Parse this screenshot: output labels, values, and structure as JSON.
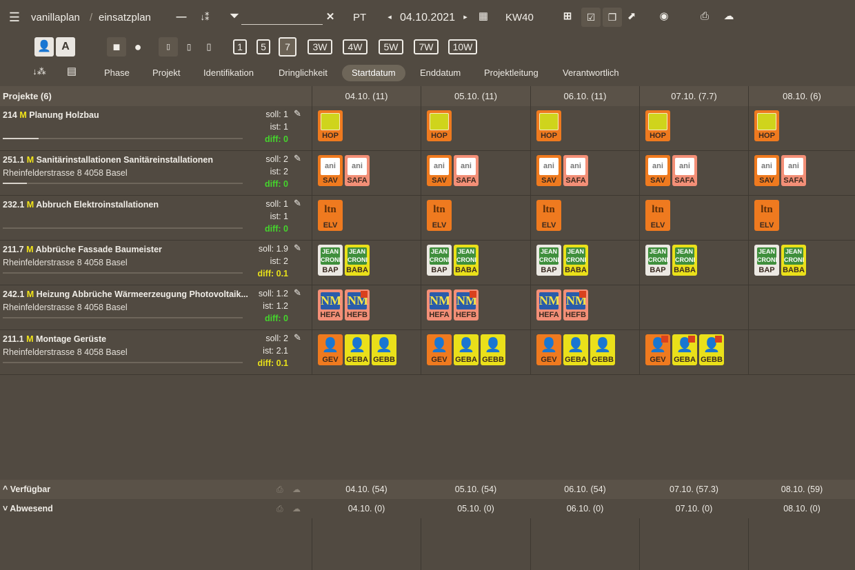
{
  "breadcrumb": {
    "root": "vanillaplan",
    "sep": "/",
    "page": "einsatzplan"
  },
  "toolbar": {
    "minus": "—",
    "sort": "↓⁑",
    "filter_clear": "✕",
    "view_mode": "PT",
    "prev": "◂",
    "date": "04.10.2021",
    "next": "▸",
    "week": "KW40",
    "zoom_options": [
      "1",
      "5",
      "7",
      "3W",
      "4W",
      "5W",
      "7W",
      "10W"
    ],
    "zoom_active": "7"
  },
  "sort_tabs": [
    "Phase",
    "Projekt",
    "Identifikation",
    "Dringlichkeit",
    "Startdatum",
    "Enddatum",
    "Projektleitung",
    "Verantwortlich"
  ],
  "sort_active": "Startdatum",
  "grid": {
    "header_title": "Projekte (6)",
    "days": [
      "04.10. (11)",
      "05.10. (11)",
      "06.10. (11)",
      "07.10. (7.7)",
      "08.10. (6)"
    ]
  },
  "projects": [
    {
      "num": "214",
      "m": "M",
      "name": "Planung Holzbau",
      "address": "",
      "soll": "soll: 1",
      "ist": "ist: 1",
      "diff": "diff: 0",
      "diff_color": "#44d62c",
      "progress": 0.15
    },
    {
      "num": "251.1",
      "m": "M",
      "name": "Sanitärinstallationen Sanitäreinstallationen",
      "address": "Rheinfelderstrasse 8 4058 Basel",
      "soll": "soll: 2",
      "ist": "ist: 2",
      "diff": "diff: 0",
      "diff_color": "#44d62c",
      "progress": 0.1
    },
    {
      "num": "232.1",
      "m": "M",
      "name": "Abbruch Elektroinstallationen",
      "address": "",
      "soll": "soll: 1",
      "ist": "ist: 1",
      "diff": "diff: 0",
      "diff_color": "#44d62c",
      "progress": 0.0
    },
    {
      "num": "211.7",
      "m": "M",
      "name": "Abbrüche Fassade Baumeister",
      "address": "Rheinfelderstrasse 8 4058 Basel",
      "soll": "soll: 1.9",
      "ist": "ist: 2",
      "diff": "diff: 0.1",
      "diff_color": "#e8e01a",
      "progress": 0.0
    },
    {
      "num": "242.1",
      "m": "M",
      "name": "Heizung Abbrüche Wärmeerzeugung Photovoltaik...",
      "address": "Rheinfelderstrasse 8 4058 Basel",
      "soll": "soll: 1.2",
      "ist": "ist: 1.2",
      "diff": "diff: 0",
      "diff_color": "#44d62c",
      "progress": 0.0
    },
    {
      "num": "211.1",
      "m": "M",
      "name": "Montage Gerüste",
      "address": "Rheinfelderstrasse 8 4058 Basel",
      "soll": "soll: 2",
      "ist": "ist: 2.1",
      "diff": "diff: 0.1",
      "diff_color": "#e8e01a",
      "progress": 0.0
    }
  ],
  "assignments": [
    [
      [
        {
          "code": "HOP",
          "color": "#ef7a1f",
          "logo": "yel"
        }
      ],
      [
        {
          "code": "HOP",
          "color": "#ef7a1f",
          "logo": "yel"
        }
      ],
      [
        {
          "code": "HOP",
          "color": "#ef7a1f",
          "logo": "yel"
        }
      ],
      [
        {
          "code": "HOP",
          "color": "#ef7a1f",
          "logo": "yel"
        }
      ],
      [
        {
          "code": "HOP",
          "color": "#ef7a1f",
          "logo": "yel"
        }
      ]
    ],
    [
      [
        {
          "code": "SAV",
          "color": "#ef7a1f",
          "logo": "an"
        },
        {
          "code": "SAFA",
          "color": "#f38f77",
          "logo": "an"
        }
      ],
      [
        {
          "code": "SAV",
          "color": "#ef7a1f",
          "logo": "an"
        },
        {
          "code": "SAFA",
          "color": "#f38f77",
          "logo": "an"
        }
      ],
      [
        {
          "code": "SAV",
          "color": "#ef7a1f",
          "logo": "an"
        },
        {
          "code": "SAFA",
          "color": "#f38f77",
          "logo": "an"
        }
      ],
      [
        {
          "code": "SAV",
          "color": "#ef7a1f",
          "logo": "an"
        },
        {
          "code": "SAFA",
          "color": "#f38f77",
          "logo": "an"
        }
      ],
      [
        {
          "code": "SAV",
          "color": "#ef7a1f",
          "logo": "an"
        },
        {
          "code": "SAFA",
          "color": "#f38f77",
          "logo": "an"
        }
      ]
    ],
    [
      [
        {
          "code": "ELV",
          "color": "#ef7a1f",
          "logo": "ltn"
        }
      ],
      [
        {
          "code": "ELV",
          "color": "#ef7a1f",
          "logo": "ltn"
        }
      ],
      [
        {
          "code": "ELV",
          "color": "#ef7a1f",
          "logo": "ltn"
        }
      ],
      [
        {
          "code": "ELV",
          "color": "#ef7a1f",
          "logo": "ltn"
        }
      ],
      [
        {
          "code": "ELV",
          "color": "#ef7a1f",
          "logo": "ltn"
        }
      ]
    ],
    [
      [
        {
          "code": "BAP",
          "color": "#ece9e3",
          "logo": "jc"
        },
        {
          "code": "BABA",
          "color": "#eae01a",
          "logo": "jc"
        }
      ],
      [
        {
          "code": "BAP",
          "color": "#ece9e3",
          "logo": "jc"
        },
        {
          "code": "BABA",
          "color": "#eae01a",
          "logo": "jc"
        }
      ],
      [
        {
          "code": "BAP",
          "color": "#ece9e3",
          "logo": "jc"
        },
        {
          "code": "BABA",
          "color": "#eae01a",
          "logo": "jc"
        }
      ],
      [
        {
          "code": "BAP",
          "color": "#ece9e3",
          "logo": "jc"
        },
        {
          "code": "BABA",
          "color": "#eae01a",
          "logo": "jc"
        }
      ],
      [
        {
          "code": "BAP",
          "color": "#ece9e3",
          "logo": "jc"
        },
        {
          "code": "BABA",
          "color": "#eae01a",
          "logo": "jc"
        }
      ]
    ],
    [
      [
        {
          "code": "HEFA",
          "color": "#f38f77",
          "logo": "nm"
        },
        {
          "code": "HEFB",
          "color": "#f38f77",
          "logo": "nm",
          "flag": true
        }
      ],
      [
        {
          "code": "HEFA",
          "color": "#f38f77",
          "logo": "nm"
        },
        {
          "code": "HEFB",
          "color": "#f38f77",
          "logo": "nm",
          "flag": true
        }
      ],
      [
        {
          "code": "HEFA",
          "color": "#f38f77",
          "logo": "nm"
        },
        {
          "code": "HEFB",
          "color": "#f38f77",
          "logo": "nm",
          "flag": true
        }
      ],
      [],
      []
    ],
    [
      [
        {
          "code": "GEV",
          "color": "#ef7a1f",
          "logo": "person"
        },
        {
          "code": "GEBA",
          "color": "#eae01a",
          "logo": "person"
        },
        {
          "code": "GEBB",
          "color": "#eae01a",
          "logo": "person"
        }
      ],
      [
        {
          "code": "GEV",
          "color": "#ef7a1f",
          "logo": "person"
        },
        {
          "code": "GEBA",
          "color": "#eae01a",
          "logo": "person"
        },
        {
          "code": "GEBB",
          "color": "#eae01a",
          "logo": "person"
        }
      ],
      [
        {
          "code": "GEV",
          "color": "#ef7a1f",
          "logo": "person"
        },
        {
          "code": "GEBA",
          "color": "#eae01a",
          "logo": "person"
        },
        {
          "code": "GEBB",
          "color": "#eae01a",
          "logo": "person"
        }
      ],
      [
        {
          "code": "GEV",
          "color": "#ef7a1f",
          "logo": "person",
          "flag": true
        },
        {
          "code": "GEBA",
          "color": "#eae01a",
          "logo": "person",
          "flag": true
        },
        {
          "code": "GEBB",
          "color": "#eae01a",
          "logo": "person",
          "flag": true
        }
      ],
      []
    ]
  ],
  "logos": {
    "an": "ani",
    "ltn": "ltn",
    "jc": "JEAN CRONI",
    "nm": "NM",
    "person": "👤",
    "yel": ""
  },
  "footer": {
    "available_label": "^ Verfügbar",
    "available": [
      "04.10. (54)",
      "05.10. (54)",
      "06.10. (54)",
      "07.10. (57.3)",
      "08.10. (59)"
    ],
    "absent_label": "˅ Abwesend",
    "absent": [
      "04.10. (0)",
      "05.10. (0)",
      "06.10. (0)",
      "07.10. (0)",
      "08.10. (0)"
    ]
  }
}
